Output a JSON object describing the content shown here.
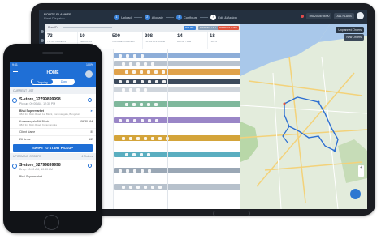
{
  "tablet": {
    "brand_line1": "ROUTE PLANNER",
    "brand_line2": "Fleet Dispatch",
    "steps": [
      {
        "num": "1",
        "label": "Upload",
        "active": false
      },
      {
        "num": "2",
        "label": "Allocate",
        "active": false
      },
      {
        "num": "3",
        "label": "Configure",
        "active": false
      },
      {
        "num": "4",
        "label": "Edit & Assign",
        "active": true
      }
    ],
    "date_box": "Thu 20/08 08:00",
    "plans_button": "ALL PLANS",
    "subbar": {
      "label": "Plan ID",
      "btn_primary": "ROUTE",
      "btn_secondary": "DISPATCH ALL",
      "btn_danger": "DISPATCH VAN"
    },
    "stats": [
      {
        "value": "73",
        "label": "TOTAL ORDERS"
      },
      {
        "value": "10",
        "label": "VEHICLES"
      },
      {
        "value": "500",
        "label": "VOLUME PLANNED"
      },
      {
        "value": "298",
        "label": "TOTAL DISTANCE"
      },
      {
        "value": "14",
        "label": "DRIVE TIME"
      },
      {
        "value": "18",
        "label": "TRIPS"
      }
    ],
    "map_pill": "Unplanned Orders",
    "map_pill2": "New Orders"
  },
  "phone": {
    "status_left": "9:41",
    "status_right": "100%",
    "title": "HOME",
    "toggle": [
      "Ongoing",
      "Done"
    ],
    "current_section": "CURRENT LIST",
    "current_order": {
      "id": "S-store_32799899998",
      "sub": "Pickup: 09:00 AM, 12:30 PM",
      "pickup_title": "Bhai Supermarket",
      "pickup_addr": "382, 3rd Main Road, 1st Block, Koramangala, Bengaluru",
      "drop_title": "Koramangala 5th Block",
      "drop_addr": "382, 3rd Main Road, Koramangala",
      "drop_time": "09:30 AM",
      "contact": "Client Name",
      "items": "26 Items",
      "items_right": "1/2",
      "swipe": "SWIPE TO START PICKUP"
    },
    "upcoming_section": "UPCOMING ORDERS",
    "upcoming_right": "4 Orders",
    "next_order": {
      "id": "S-store_32799899998",
      "sub": "Drop: 10:00 AM, 10:30 AM",
      "line": "Bhai Supermarket"
    }
  }
}
